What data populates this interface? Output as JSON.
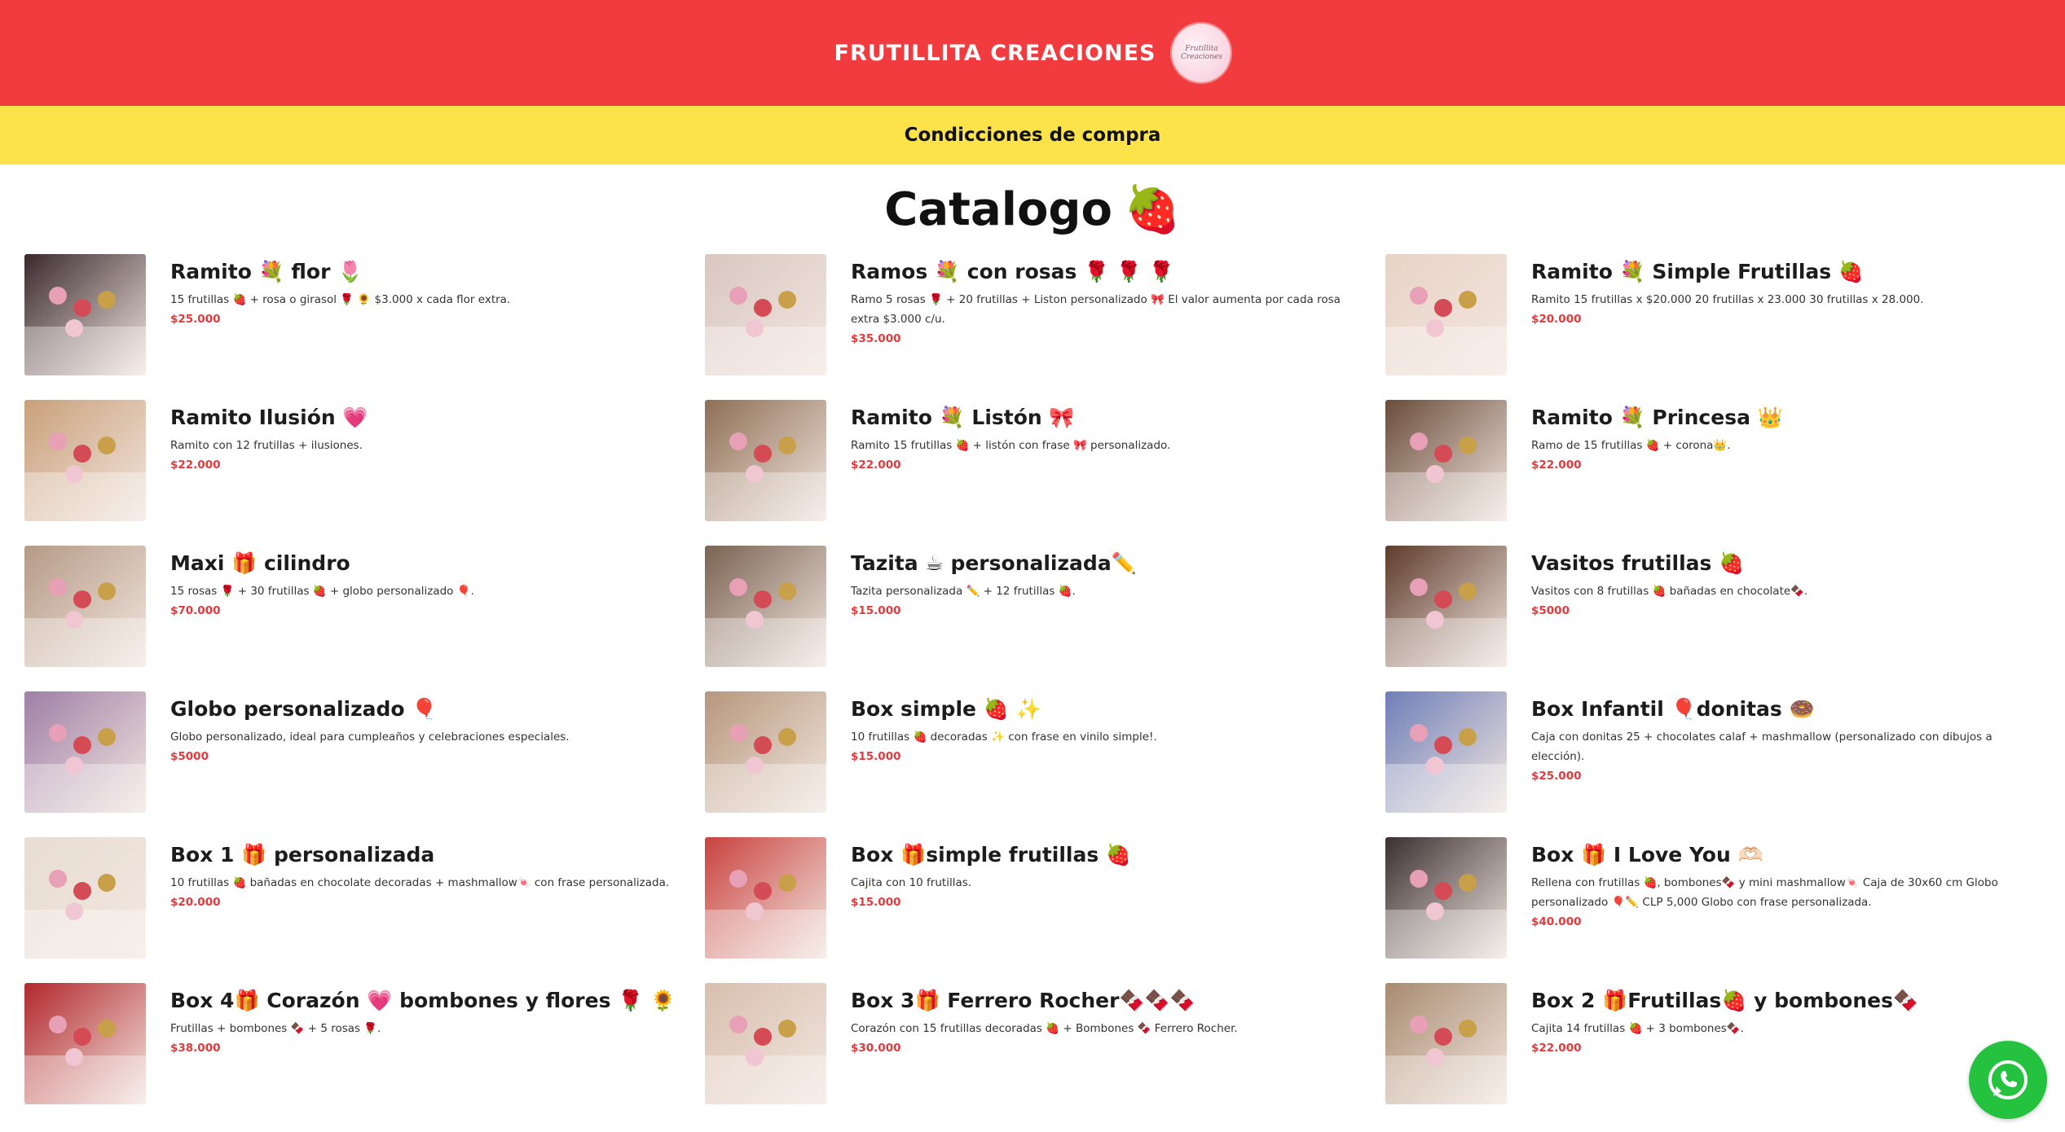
{
  "header": {
    "brand": "FRUTILLITA CREACIONES",
    "logo_text": "Frutillita Creaciones",
    "background": "#f23b3e"
  },
  "conditions": {
    "label": "Condicciones de compra",
    "background": "#fce349"
  },
  "catalog": {
    "title": "Catalogo",
    "emoji": "🍓"
  },
  "accent_price_color": "#e5393b",
  "products": [
    {
      "name": "Ramito 💐 flor 🌷",
      "desc": "15 frutillas 🍓 + rosa o girasol 🌹 🌻 $3.000 x cada flor extra.",
      "price": "$25.000",
      "tone": "#3a2a2e"
    },
    {
      "name": "Ramos 💐 con rosas 🌹 🌹 🌹",
      "desc": "Ramo 5 rosas 🌹 + 20 frutillas + Liston personalizado 🎀 El valor aumenta por cada rosa extra $3.000 c/u.",
      "price": "$35.000",
      "tone": "#d9c7c1"
    },
    {
      "name": "Ramito 💐 Simple Frutillas 🍓",
      "desc": "Ramito 15 frutillas x $20.000 20 frutillas x 23.000 30 frutillas x 28.000.",
      "price": "$20.000",
      "tone": "#e8d3c6"
    },
    {
      "name": "Ramito Ilusión 💗",
      "desc": "Ramito con 12 frutillas + ilusiones.",
      "price": "$22.000",
      "tone": "#c9a07a"
    },
    {
      "name": "Ramito 💐 Listón 🎀",
      "desc": "Ramito 15 frutillas 🍓 + listón con frase 🎀 personalizado.",
      "price": "$22.000",
      "tone": "#8e6f55"
    },
    {
      "name": "Ramito 💐 Princesa 👑",
      "desc": "Ramo de 15 frutillas 🍓 + corona👑.",
      "price": "$22.000",
      "tone": "#6a4c3a"
    },
    {
      "name": "Maxi 🎁 cilindro",
      "desc": "15 rosas 🌹 + 30 frutillas 🍓 + globo personalizado 🎈.",
      "price": "$70.000",
      "tone": "#b59a86"
    },
    {
      "name": "Tazita ☕ personalizada✏️",
      "desc": "Tazita personalizada ✏️ + 12 frutillas 🍓.",
      "price": "$15.000",
      "tone": "#7a6352"
    },
    {
      "name": "Vasitos frutillas 🍓",
      "desc": "Vasitos con 8 frutillas 🍓 bañadas en chocolate🍫.",
      "price": "$5000",
      "tone": "#5e3c2c"
    },
    {
      "name": "Globo personalizado 🎈",
      "desc": "Globo personalizado, ideal para cumpleaños y celebraciones especiales.",
      "price": "$5000",
      "tone": "#9f7fa7"
    },
    {
      "name": "Box simple 🍓 ✨",
      "desc": "10 frutillas 🍓 decoradas ✨ con frase en vinilo simple!.",
      "price": "$15.000",
      "tone": "#b6977c"
    },
    {
      "name": "Box Infantil 🎈donitas 🍩",
      "desc": "Caja con donitas 25 + chocolates calaf + mashmallow (personalizado con dibujos a elección).",
      "price": "$25.000",
      "tone": "#6f7fb8"
    },
    {
      "name": "Box 1 🎁 personalizada",
      "desc": "10 frutillas 🍓 bañadas en chocolate decoradas + mashmallow🍬 con frase personalizada.",
      "price": "$20.000",
      "tone": "#e8ddd2"
    },
    {
      "name": "Box 🎁simple frutillas 🍓",
      "desc": "Cajita con 10 frutillas.",
      "price": "$15.000",
      "tone": "#c9423f"
    },
    {
      "name": "Box 🎁 I Love You 🫶🏻",
      "desc": "Rellena con frutillas 🍓, bombones🍫 y mini mashmallow🍬 Caja de 30x60 cm Globo personalizado 🎈✏️ CLP 5,000 Globo con frase personalizada.",
      "price": "$40.000",
      "tone": "#3a3030"
    },
    {
      "name": "Box 4🎁 Corazón 💗 bombones y flores 🌹 🌻",
      "desc": "Frutillas + bombones 🍫 + 5 rosas 🌹.",
      "price": "$38.000",
      "tone": "#b2272c"
    },
    {
      "name": "Box 3🎁 Ferrero Rocher🍫🍫🍫",
      "desc": "Corazón con 15 frutillas decoradas 🍓 + Bombones 🍫 Ferrero Rocher.",
      "price": "$30.000",
      "tone": "#d8bfae"
    },
    {
      "name": "Box 2 🎁Frutillas🍓 y bombones🍫",
      "desc": "Cajita 14 frutillas 🍓 + 3 bombones🍫.",
      "price": "$22.000",
      "tone": "#a88b70"
    }
  ],
  "whatsapp": {
    "icon": "whatsapp-icon",
    "color": "#25c23f"
  }
}
